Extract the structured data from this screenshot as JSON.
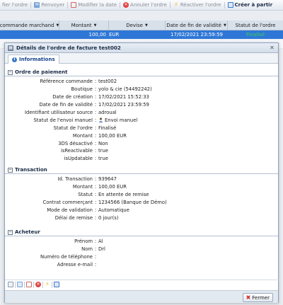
{
  "toolbar": {
    "items": [
      {
        "label": "fier l'ordre",
        "icon": "edit-icon",
        "active": false
      },
      {
        "label": "Renvoyer",
        "icon": "resend-icon",
        "active": false
      },
      {
        "label": "Modifier la date",
        "icon": "calendar-icon",
        "active": false
      },
      {
        "label": "Annuler l'ordre",
        "icon": "cancel-icon",
        "active": false
      },
      {
        "label": "Réactiver l'ordre",
        "icon": "reactivate-icon",
        "active": false
      },
      {
        "label": "Créer à partir",
        "icon": "copy-icon",
        "active": true
      }
    ]
  },
  "grid": {
    "columns": [
      "commande marchand",
      "Montant",
      "Devise",
      "Date de fin de validité",
      "Statut de l'ordre"
    ],
    "selected_row": [
      "",
      "100,00",
      "EUR",
      "17/02/2021 23:59:59",
      "Finalisé"
    ]
  },
  "dialog": {
    "title": "Détails de l'ordre de facture test002",
    "tab": "Informations",
    "sections": {
      "payment": {
        "title": "Ordre de paiement",
        "rows": [
          {
            "label": "Référence commande",
            "value": "test002"
          },
          {
            "label": "Boutique",
            "value": "yolo & cie (54492242)"
          },
          {
            "label": "Date de création",
            "value": "17/02/2021 15:52:33"
          },
          {
            "label": "Date de fin de validité",
            "value": "17/02/2021 23:59:59"
          },
          {
            "label": "Identifiant utilisateur source",
            "value": "adroual"
          },
          {
            "label": "Statut de l'envoi manuel",
            "value": "Envoi manuel"
          },
          {
            "label": "Statut de l'ordre",
            "value": "Finalisé"
          },
          {
            "label": "Montant",
            "value": "100,00 EUR"
          },
          {
            "label": "3DS désactivé",
            "value": "Non"
          },
          {
            "label": "isReactivable",
            "value": "true"
          },
          {
            "label": "isUpdatable",
            "value": "true"
          }
        ]
      },
      "transaction": {
        "title": "Transaction",
        "rows": [
          {
            "label": "Id. Transaction",
            "value": "939647"
          },
          {
            "label": "Montant",
            "value": "100,00 EUR"
          },
          {
            "label": "Statut",
            "value": "En attente de remise"
          },
          {
            "label": "Contrat commerçant",
            "value": "1234566 (Banque de Démo)"
          },
          {
            "label": "Mode de validation",
            "value": "Automatique"
          },
          {
            "label": "Délai de remise",
            "value": "0 jour(s)"
          }
        ]
      },
      "buyer": {
        "title": "Acheteur",
        "rows": [
          {
            "label": "Prénom",
            "value": "Al"
          },
          {
            "label": "Nom",
            "value": "Drl"
          },
          {
            "label": "Numéro de téléphone",
            "value": ""
          },
          {
            "label": "Adresse e-mail",
            "value": ""
          }
        ]
      }
    },
    "close_label": "Fermer"
  },
  "colors": {
    "selection": "#2e77d6",
    "status_finalise": "#3ecf5a",
    "accent": "#15428b"
  }
}
